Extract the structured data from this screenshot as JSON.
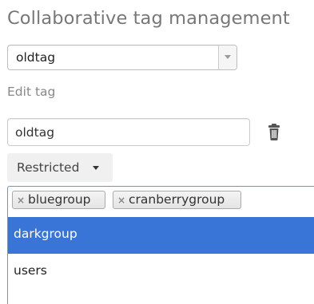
{
  "page": {
    "title": "Collaborative tag management"
  },
  "tag_select": {
    "value": "oldtag"
  },
  "edit_section": {
    "label": "Edit tag",
    "name_input_value": "oldtag",
    "delete_icon": "trash-icon"
  },
  "restriction_dropdown": {
    "label": "Restricted",
    "icon": "caret-down-icon"
  },
  "group_multiselect": {
    "selected": [
      {
        "label": "bluegroup",
        "remove_glyph": "×"
      },
      {
        "label": "cranberrygroup",
        "remove_glyph": "×"
      }
    ],
    "options": [
      {
        "label": "darkgroup",
        "highlighted": true
      },
      {
        "label": "users",
        "highlighted": false
      }
    ],
    "highlight_color": "#3875d7",
    "focus_border_color": "#5897fb"
  }
}
